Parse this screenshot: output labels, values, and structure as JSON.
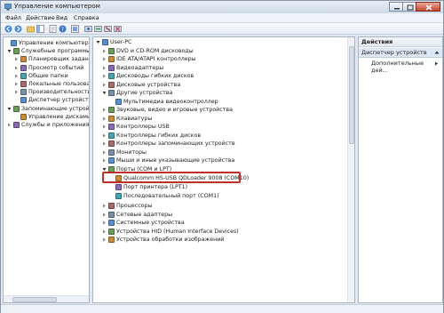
{
  "window": {
    "title": "Управление компьютером"
  },
  "menubar": [
    {
      "label": "Файл"
    },
    {
      "label": "Действие"
    },
    {
      "label": "Вид"
    },
    {
      "label": "Справка"
    }
  ],
  "left_tree": [
    {
      "label": "Управление компьютером (л",
      "icon": "computer-management-icon",
      "exp": ""
    },
    {
      "label": "Служебные программы",
      "icon": "tools-icon",
      "exp": "open"
    },
    {
      "label": "Планировщик заданий",
      "icon": "scheduler-icon",
      "exp": "closed"
    },
    {
      "label": "Просмотр событий",
      "icon": "event-viewer-icon",
      "exp": "closed"
    },
    {
      "label": "Общие папки",
      "icon": "shared-folders-icon",
      "exp": "closed"
    },
    {
      "label": "Локальные пользоват",
      "icon": "users-icon",
      "exp": "closed"
    },
    {
      "label": "Производительность",
      "icon": "performance-icon",
      "exp": "closed"
    },
    {
      "label": "Диспетчер устройств",
      "icon": "device-manager-icon",
      "exp": ""
    },
    {
      "label": "Запоминающие устройств",
      "icon": "storage-icon",
      "exp": "open"
    },
    {
      "label": "Управление дисками",
      "icon": "disk-management-icon",
      "exp": ""
    },
    {
      "label": "Службы и приложения",
      "icon": "services-icon",
      "exp": "closed"
    }
  ],
  "device_tree": [
    {
      "label": "User-PC",
      "icon": "computer-icon",
      "exp": "open"
    },
    {
      "label": "DVD и CD-ROM дисководы",
      "icon": "dvd-icon",
      "exp": "closed"
    },
    {
      "label": "IDE ATA/ATAPI контроллеры",
      "icon": "ide-icon",
      "exp": "closed"
    },
    {
      "label": "Видеоадаптеры",
      "icon": "video-icon",
      "exp": "closed"
    },
    {
      "label": "Дисководы гибких дисков",
      "icon": "floppy-icon",
      "exp": "closed"
    },
    {
      "label": "Дисковые устройства",
      "icon": "disk-icon",
      "exp": "closed"
    },
    {
      "label": "Другие устройства",
      "icon": "other-devices-icon",
      "exp": "open"
    },
    {
      "label": "Мультимедиа видеоконтроллер",
      "icon": "unknown-device-icon",
      "exp": ""
    },
    {
      "label": "Звуковые, видео и игровые устройства",
      "icon": "sound-icon",
      "exp": "closed"
    },
    {
      "label": "Клавиатуры",
      "icon": "keyboard-icon",
      "exp": "closed"
    },
    {
      "label": "Контроллеры USB",
      "icon": "usb-icon",
      "exp": "closed"
    },
    {
      "label": "Контроллеры гибких дисков",
      "icon": "floppy-controller-icon",
      "exp": "closed"
    },
    {
      "label": "Контроллеры запоминающих устройств",
      "icon": "storage-controller-icon",
      "exp": "closed"
    },
    {
      "label": "Мониторы",
      "icon": "monitor-icon",
      "exp": "closed"
    },
    {
      "label": "Мыши и иные указывающие устройства",
      "icon": "mouse-icon",
      "exp": "closed"
    },
    {
      "label": "Порты (COM и LPT)",
      "icon": "ports-icon",
      "exp": "open"
    },
    {
      "label": "Qualcomm HS-USB QDLoader 9008 (COM10)",
      "icon": "port-icon",
      "exp": ""
    },
    {
      "label": "Порт принтера (LPT1)",
      "icon": "port-icon",
      "exp": ""
    },
    {
      "label": "Последовательный порт (COM1)",
      "icon": "port-icon",
      "exp": ""
    },
    {
      "label": "Процессоры",
      "icon": "cpu-icon",
      "exp": "closed"
    },
    {
      "label": "Сетевые адаптеры",
      "icon": "network-icon",
      "exp": "closed"
    },
    {
      "label": "Системные устройства",
      "icon": "system-icon",
      "exp": "closed"
    },
    {
      "label": "Устройства HID (Human Interface Devices)",
      "icon": "hid-icon",
      "exp": "closed"
    },
    {
      "label": "Устройства обработки изображений",
      "icon": "imaging-icon",
      "exp": "closed"
    }
  ],
  "actions": {
    "header": "Действия",
    "section": "Диспетчер устройств",
    "item": "Дополнительные дей..."
  },
  "colors": {
    "highlight": "#c0302a",
    "selection": "#dde8f6"
  }
}
